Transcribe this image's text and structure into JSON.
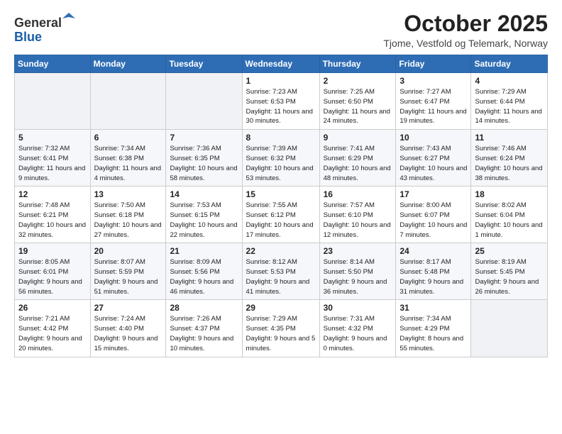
{
  "logo": {
    "general": "General",
    "blue": "Blue"
  },
  "title": "October 2025",
  "location": "Tjome, Vestfold og Telemark, Norway",
  "days_header": [
    "Sunday",
    "Monday",
    "Tuesday",
    "Wednesday",
    "Thursday",
    "Friday",
    "Saturday"
  ],
  "weeks": [
    [
      {
        "day": "",
        "info": ""
      },
      {
        "day": "",
        "info": ""
      },
      {
        "day": "",
        "info": ""
      },
      {
        "day": "1",
        "info": "Sunrise: 7:23 AM\nSunset: 6:53 PM\nDaylight: 11 hours\nand 30 minutes."
      },
      {
        "day": "2",
        "info": "Sunrise: 7:25 AM\nSunset: 6:50 PM\nDaylight: 11 hours\nand 24 minutes."
      },
      {
        "day": "3",
        "info": "Sunrise: 7:27 AM\nSunset: 6:47 PM\nDaylight: 11 hours\nand 19 minutes."
      },
      {
        "day": "4",
        "info": "Sunrise: 7:29 AM\nSunset: 6:44 PM\nDaylight: 11 hours\nand 14 minutes."
      }
    ],
    [
      {
        "day": "5",
        "info": "Sunrise: 7:32 AM\nSunset: 6:41 PM\nDaylight: 11 hours\nand 9 minutes."
      },
      {
        "day": "6",
        "info": "Sunrise: 7:34 AM\nSunset: 6:38 PM\nDaylight: 11 hours\nand 4 minutes."
      },
      {
        "day": "7",
        "info": "Sunrise: 7:36 AM\nSunset: 6:35 PM\nDaylight: 10 hours\nand 58 minutes."
      },
      {
        "day": "8",
        "info": "Sunrise: 7:39 AM\nSunset: 6:32 PM\nDaylight: 10 hours\nand 53 minutes."
      },
      {
        "day": "9",
        "info": "Sunrise: 7:41 AM\nSunset: 6:29 PM\nDaylight: 10 hours\nand 48 minutes."
      },
      {
        "day": "10",
        "info": "Sunrise: 7:43 AM\nSunset: 6:27 PM\nDaylight: 10 hours\nand 43 minutes."
      },
      {
        "day": "11",
        "info": "Sunrise: 7:46 AM\nSunset: 6:24 PM\nDaylight: 10 hours\nand 38 minutes."
      }
    ],
    [
      {
        "day": "12",
        "info": "Sunrise: 7:48 AM\nSunset: 6:21 PM\nDaylight: 10 hours\nand 32 minutes."
      },
      {
        "day": "13",
        "info": "Sunrise: 7:50 AM\nSunset: 6:18 PM\nDaylight: 10 hours\nand 27 minutes."
      },
      {
        "day": "14",
        "info": "Sunrise: 7:53 AM\nSunset: 6:15 PM\nDaylight: 10 hours\nand 22 minutes."
      },
      {
        "day": "15",
        "info": "Sunrise: 7:55 AM\nSunset: 6:12 PM\nDaylight: 10 hours\nand 17 minutes."
      },
      {
        "day": "16",
        "info": "Sunrise: 7:57 AM\nSunset: 6:10 PM\nDaylight: 10 hours\nand 12 minutes."
      },
      {
        "day": "17",
        "info": "Sunrise: 8:00 AM\nSunset: 6:07 PM\nDaylight: 10 hours\nand 7 minutes."
      },
      {
        "day": "18",
        "info": "Sunrise: 8:02 AM\nSunset: 6:04 PM\nDaylight: 10 hours\nand 1 minute."
      }
    ],
    [
      {
        "day": "19",
        "info": "Sunrise: 8:05 AM\nSunset: 6:01 PM\nDaylight: 9 hours\nand 56 minutes."
      },
      {
        "day": "20",
        "info": "Sunrise: 8:07 AM\nSunset: 5:59 PM\nDaylight: 9 hours\nand 51 minutes."
      },
      {
        "day": "21",
        "info": "Sunrise: 8:09 AM\nSunset: 5:56 PM\nDaylight: 9 hours\nand 46 minutes."
      },
      {
        "day": "22",
        "info": "Sunrise: 8:12 AM\nSunset: 5:53 PM\nDaylight: 9 hours\nand 41 minutes."
      },
      {
        "day": "23",
        "info": "Sunrise: 8:14 AM\nSunset: 5:50 PM\nDaylight: 9 hours\nand 36 minutes."
      },
      {
        "day": "24",
        "info": "Sunrise: 8:17 AM\nSunset: 5:48 PM\nDaylight: 9 hours\nand 31 minutes."
      },
      {
        "day": "25",
        "info": "Sunrise: 8:19 AM\nSunset: 5:45 PM\nDaylight: 9 hours\nand 26 minutes."
      }
    ],
    [
      {
        "day": "26",
        "info": "Sunrise: 7:21 AM\nSunset: 4:42 PM\nDaylight: 9 hours\nand 20 minutes."
      },
      {
        "day": "27",
        "info": "Sunrise: 7:24 AM\nSunset: 4:40 PM\nDaylight: 9 hours\nand 15 minutes."
      },
      {
        "day": "28",
        "info": "Sunrise: 7:26 AM\nSunset: 4:37 PM\nDaylight: 9 hours\nand 10 minutes."
      },
      {
        "day": "29",
        "info": "Sunrise: 7:29 AM\nSunset: 4:35 PM\nDaylight: 9 hours\nand 5 minutes."
      },
      {
        "day": "30",
        "info": "Sunrise: 7:31 AM\nSunset: 4:32 PM\nDaylight: 9 hours\nand 0 minutes."
      },
      {
        "day": "31",
        "info": "Sunrise: 7:34 AM\nSunset: 4:29 PM\nDaylight: 8 hours\nand 55 minutes."
      },
      {
        "day": "",
        "info": ""
      }
    ]
  ]
}
